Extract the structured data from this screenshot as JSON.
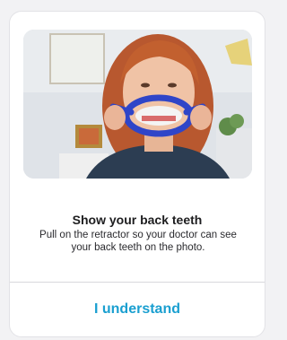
{
  "dialog": {
    "title": "Show your back teeth",
    "message": "Pull on the retractor so your doctor can see your back teeth on the photo.",
    "confirm_label": "I understand"
  },
  "illustration": {
    "icon": "photo-of-woman-using-cheek-retractor",
    "retractor_color": "#2f45c8",
    "accent_color": "#1a9fd0"
  }
}
